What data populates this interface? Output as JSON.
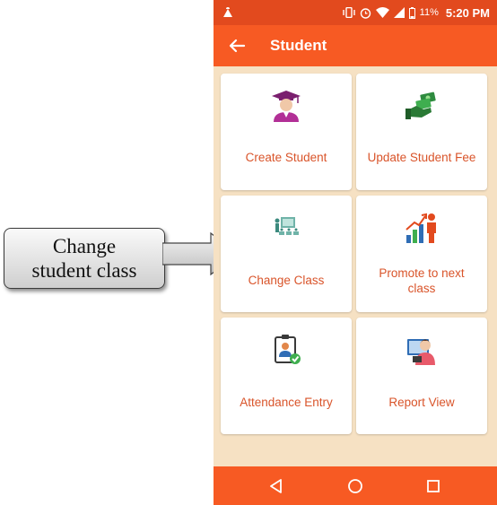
{
  "callout": {
    "line1": "Change",
    "line2": "student class"
  },
  "status_bar": {
    "battery": "11%",
    "time": "5:20 PM"
  },
  "app_bar": {
    "title": "Student"
  },
  "tiles": [
    {
      "label": "Create Student",
      "icon": "student-graduate-icon"
    },
    {
      "label": "Update Student Fee",
      "icon": "money-hand-icon"
    },
    {
      "label": "Change Class",
      "icon": "classroom-icon"
    },
    {
      "line1": "Promote to next",
      "line2": "class",
      "icon": "growth-chart-icon"
    },
    {
      "label": "Attendance Entry",
      "icon": "id-badge-check-icon"
    },
    {
      "label": "Report View",
      "icon": "report-user-icon"
    }
  ],
  "colors": {
    "primary": "#f75a23",
    "status": "#e24a1e",
    "background": "#f6e1c3",
    "label": "#d9542a"
  }
}
